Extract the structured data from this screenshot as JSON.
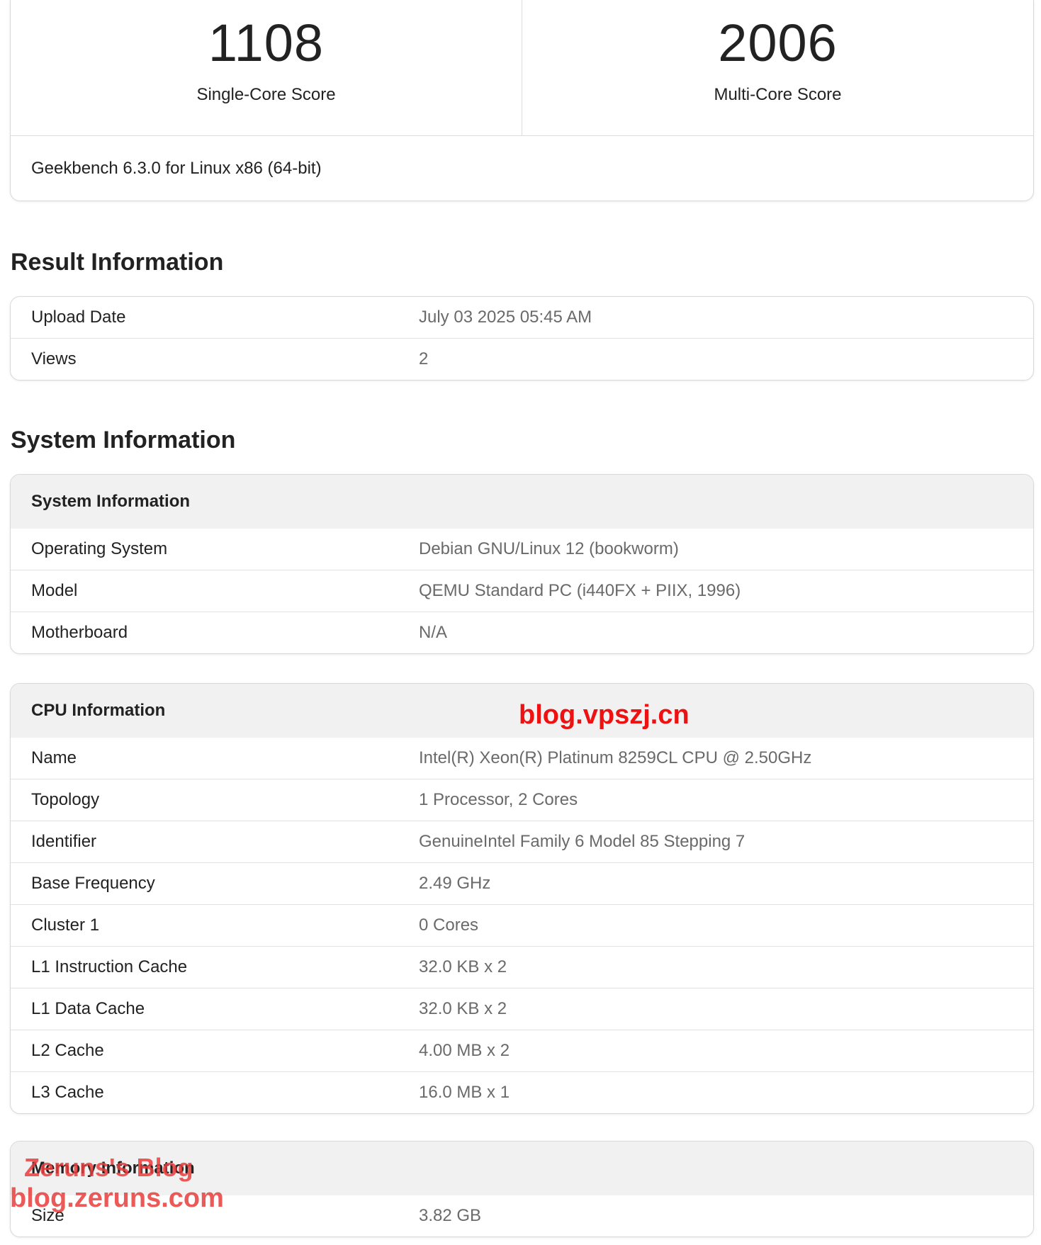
{
  "scores": {
    "single_value": "1108",
    "single_label": "Single-Core Score",
    "multi_value": "2006",
    "multi_label": "Multi-Core Score",
    "version": "Geekbench 6.3.0 for Linux x86 (64-bit)"
  },
  "result_info": {
    "title": "Result Information",
    "rows": [
      {
        "key": "Upload Date",
        "value": "July 03 2025 05:45 AM"
      },
      {
        "key": "Views",
        "value": "2"
      }
    ]
  },
  "system_info": {
    "title": "System Information",
    "system": {
      "heading": "System Information",
      "rows": [
        {
          "key": "Operating System",
          "value": "Debian GNU/Linux 12 (bookworm)"
        },
        {
          "key": "Model",
          "value": "QEMU Standard PC (i440FX + PIIX, 1996)"
        },
        {
          "key": "Motherboard",
          "value": "N/A"
        }
      ]
    },
    "cpu": {
      "heading": "CPU Information",
      "rows": [
        {
          "key": "Name",
          "value": "Intel(R) Xeon(R) Platinum 8259CL CPU @ 2.50GHz"
        },
        {
          "key": "Topology",
          "value": "1 Processor, 2 Cores"
        },
        {
          "key": "Identifier",
          "value": "GenuineIntel Family 6 Model 85 Stepping 7"
        },
        {
          "key": "Base Frequency",
          "value": "2.49 GHz"
        },
        {
          "key": "Cluster 1",
          "value": "0 Cores"
        },
        {
          "key": "L1 Instruction Cache",
          "value": "32.0 KB x 2"
        },
        {
          "key": "L1 Data Cache",
          "value": "32.0 KB x 2"
        },
        {
          "key": "L2 Cache",
          "value": "4.00 MB x 2"
        },
        {
          "key": "L3 Cache",
          "value": "16.0 MB x 1"
        }
      ]
    },
    "memory": {
      "heading": "Memory Information",
      "rows": [
        {
          "key": "Size",
          "value": "3.82 GB"
        }
      ]
    }
  },
  "watermarks": {
    "center": "blog.vpszj.cn",
    "corner_name": "Zeruns's Blog",
    "corner_url": "blog.zeruns.com"
  },
  "colors": {
    "watermark_red": "#ee1111",
    "header_bg": "#f1f1f1",
    "value_gray": "#6a6a6a"
  }
}
